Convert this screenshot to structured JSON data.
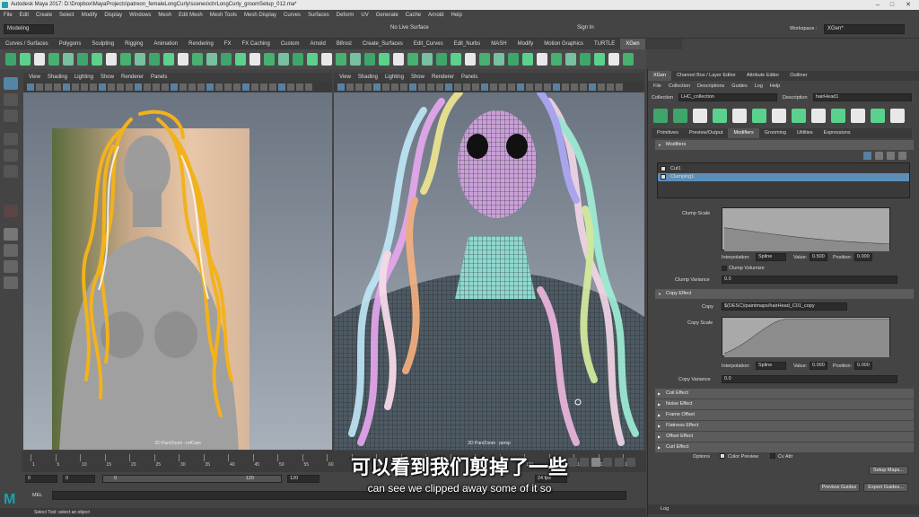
{
  "window": {
    "title": "Autodesk Maya 2017: D:\\Dropbox\\MayaProjects\\patreon_femaleLongCurly\\scenes\\chrLongCurly_groomSetup_012.ma*"
  },
  "menubar": [
    "File",
    "Edit",
    "Create",
    "Select",
    "Modify",
    "Display",
    "Windows",
    "Mesh",
    "Edit Mesh",
    "Mesh Tools",
    "Mesh Display",
    "Curves",
    "Surfaces",
    "Deform",
    "UV",
    "Generate",
    "Cache",
    "Arnold",
    "Help"
  ],
  "status": {
    "menuset": "Modeling",
    "live_surface": "No Live Surface",
    "sign_in": "Sign In",
    "workspace_label": "Workspace :",
    "workspace": "XGen*"
  },
  "shelf_tabs": [
    "Curves / Surfaces",
    "Polygons",
    "Sculpting",
    "Rigging",
    "Animation",
    "Rendering",
    "FX",
    "FX Caching",
    "Custom",
    "Arnold",
    "Bifrost",
    "Create_Surfaces",
    "Edit_Curves",
    "Edit_Nurbs",
    "MASH",
    "Modify",
    "Motion Graphics",
    "TURTLE",
    "XGen"
  ],
  "shelf_active": "XGen",
  "viewports": {
    "menu": [
      "View",
      "Shading",
      "Lighting",
      "Show",
      "Renderer",
      "Panels"
    ],
    "left_label": "2D Pan/Zoom : refCam",
    "right_label": "2D Pan/Zoom : persp"
  },
  "timeline": {
    "ticks": [
      "1",
      "5",
      "10",
      "15",
      "20",
      "25",
      "30",
      "35",
      "40",
      "45",
      "50",
      "55",
      "60",
      "65",
      "70",
      "75",
      "80",
      "85",
      "90",
      "95",
      "100",
      "105",
      "110",
      "115",
      "120"
    ],
    "range_start": "0",
    "range_start2": "0",
    "range_inner": "0",
    "range_end_inner": "120",
    "range_end": "120",
    "fps": "24 fps"
  },
  "cmdline": {
    "label": "MEL"
  },
  "helpline": "Select Tool: select an object",
  "subtitle": {
    "cn": "可以看到我们剪掉了一些",
    "en": "can see we clipped away some of it so"
  },
  "panel": {
    "tabs": [
      "XGen",
      "Channel Box / Layer Editor",
      "Attribute Editor",
      "Outliner"
    ],
    "menu": [
      "File",
      "Collection",
      "Descriptions",
      "Guides",
      "Log",
      "Help"
    ],
    "collection_label": "Collection",
    "collection": "LHC_collection",
    "description_label": "Description",
    "description": "hairHead1",
    "sub_tabs": [
      "Primitives",
      "Preview/Output",
      "Modifiers",
      "Grooming",
      "Utilities",
      "Expressions"
    ],
    "sub_active": "Modifiers",
    "modifiers_header": "Modifiers",
    "modifier_items": [
      {
        "name": "Cut1",
        "selected": false
      },
      {
        "name": "Clumping1",
        "selected": true
      }
    ],
    "clump_scale_label": "Clump Scale",
    "interp_label": "Interpolation:",
    "interp": "Spline",
    "value_label": "Value:",
    "clump_value": "0.500",
    "position_label": "Position:",
    "clump_position": "0.000",
    "clump_volumize": "Clump Volumize",
    "clump_variance_label": "Clump Variance",
    "clump_variance": "0.0",
    "copy_effect": "Copy Effect",
    "copy_label": "Copy",
    "copy_path": "$(DESC)/paintmaps/hairHead_C01_copy",
    "copy_scale_label": "Copy Scale",
    "copy_value": "0.000",
    "copy_position": "0.000",
    "copy_variance_label": "Copy Variance",
    "copy_variance": "0.0",
    "sections": [
      "Coil Effect",
      "Noise Effect",
      "Frame Offset",
      "Flatness Effect",
      "Offset Effect",
      "Curl Effect"
    ],
    "options_label": "Options",
    "color_preview": "Color Preview",
    "cv_attr": "Cv Attr",
    "setup_maps": "Setup Maps...",
    "preview_guides": "Preview Guides",
    "export_guides": "Export Guides...",
    "log": "Log"
  },
  "colors": {
    "accent": "#5285a6",
    "hair_yellow": "#f2b21c",
    "selection": "#5b8fb9"
  }
}
